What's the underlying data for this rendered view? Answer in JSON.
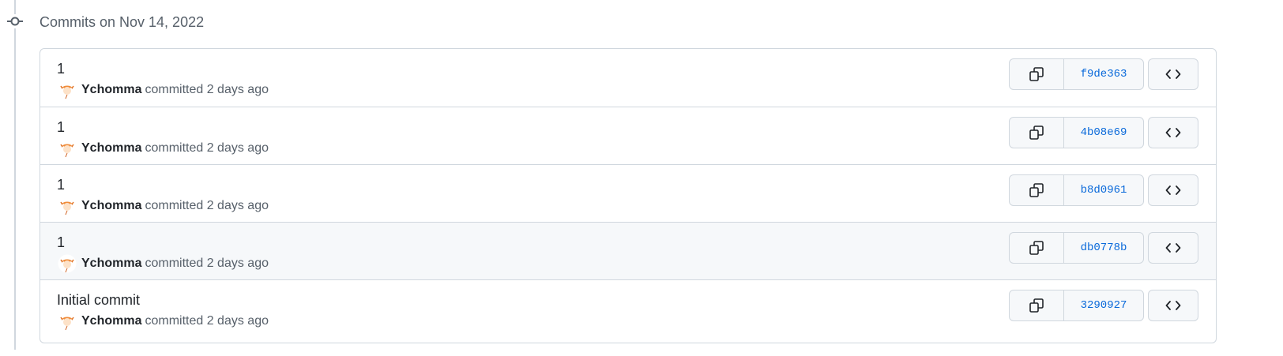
{
  "group": {
    "title": "Commits on Nov 14, 2022"
  },
  "commits": [
    {
      "message": "1",
      "author": "Ychomma",
      "time": "committed 2 days ago",
      "sha": "f9de363"
    },
    {
      "message": "1",
      "author": "Ychomma",
      "time": "committed 2 days ago",
      "sha": "4b08e69"
    },
    {
      "message": "1",
      "author": "Ychomma",
      "time": "committed 2 days ago",
      "sha": "b8d0961"
    },
    {
      "message": "1",
      "author": "Ychomma",
      "time": "committed 2 days ago",
      "sha": "db0778b"
    },
    {
      "message": "Initial commit",
      "author": "Ychomma",
      "time": "committed 2 days ago",
      "sha": "3290927"
    }
  ],
  "icons": {
    "timeline": "git-commit-icon",
    "copy": "copy-icon",
    "browse": "code-icon",
    "avatar": "avatar-image"
  },
  "colors": {
    "border": "#d0d7de",
    "muted": "#57606a",
    "link": "#0969da",
    "button_bg": "#f6f8fa",
    "hover_row": "#f6f8fa"
  }
}
